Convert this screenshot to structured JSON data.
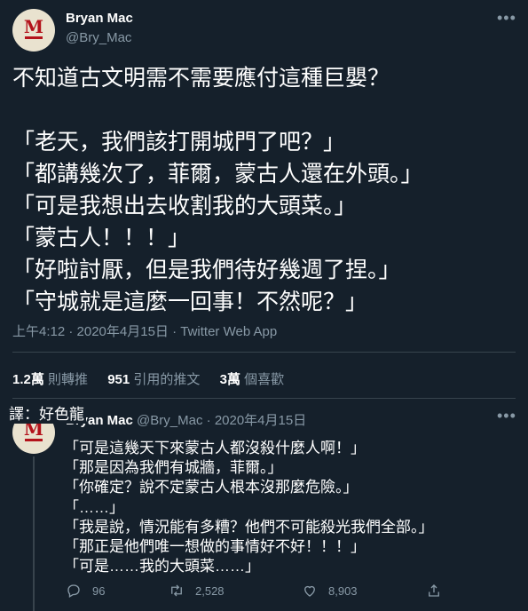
{
  "tweet1": {
    "author_name": "Bryan Mac",
    "author_handle": "@Bry_Mac",
    "lines": [
      "不知道古文明需不需要應付這種巨嬰？",
      "",
      "「老天，我們該打開城門了吧？」",
      "「都講幾次了，菲爾，蒙古人還在外頭。」",
      "「可是我想出去收割我的大頭菜。」",
      "「蒙古人！！！」",
      "「好啦討厭，但是我們待好幾週了捏。」",
      "「守城就是這麼一回事！不然呢？」"
    ],
    "meta": "上午4:12 · 2020年4月15日 · Twitter Web App",
    "stats": {
      "retweets_count": "1.2萬",
      "retweets_label": "則轉推",
      "quotes_count": "951",
      "quotes_label": "引用的推文",
      "likes_count": "3萬",
      "likes_label": "個喜歡"
    }
  },
  "translator_label": "譯：好色龍",
  "tweet2": {
    "author_name": "Bryan Mac",
    "author_handle": "@Bry_Mac",
    "date": "2020年4月15日",
    "lines": [
      "「可是這幾天下來蒙古人都沒殺什麼人啊！」",
      "「那是因為我們有城牆，菲爾。」",
      "「你確定？說不定蒙古人根本沒那麼危險。」",
      "「……」",
      "「我是說，情況能有多糟？他們不可能殺光我們全部。」",
      "「那正是他們唯一想做的事情好不好！！！」",
      "「可是……我的大頭菜……」"
    ],
    "replies": "96",
    "retweets": "2,528",
    "likes": "8,903"
  },
  "icons": {
    "reply": "reply-icon",
    "retweet": "retweet-icon",
    "like": "heart-icon",
    "share": "share-icon",
    "more": "more-icon"
  }
}
